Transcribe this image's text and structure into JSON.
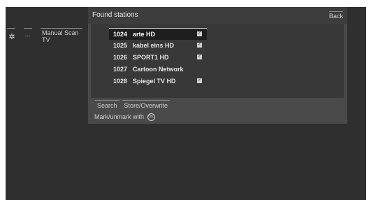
{
  "sidebar": {
    "icon_settings": "gear-icon",
    "dots": "...",
    "item_label_line1": "Manual Scan",
    "item_label_line2": "TV"
  },
  "dialog": {
    "title": "Found stations",
    "back_label": "Back",
    "stations": [
      {
        "number": "1024",
        "name": "arte HD",
        "checked": true,
        "selected": true
      },
      {
        "number": "1025",
        "name": "kabel eins HD",
        "checked": true,
        "selected": false
      },
      {
        "number": "1026",
        "name": "SPORT1 HD",
        "checked": true,
        "selected": false
      },
      {
        "number": "1027",
        "name": "Cartoon Network",
        "checked": false,
        "selected": false
      },
      {
        "number": "1028",
        "name": "Spiegel TV HD",
        "checked": true,
        "selected": false
      }
    ],
    "buttons": {
      "search": "Search",
      "store": "Store/Overwrite"
    },
    "hint": "Mark/unmark with",
    "hint_icon": "OK"
  }
}
